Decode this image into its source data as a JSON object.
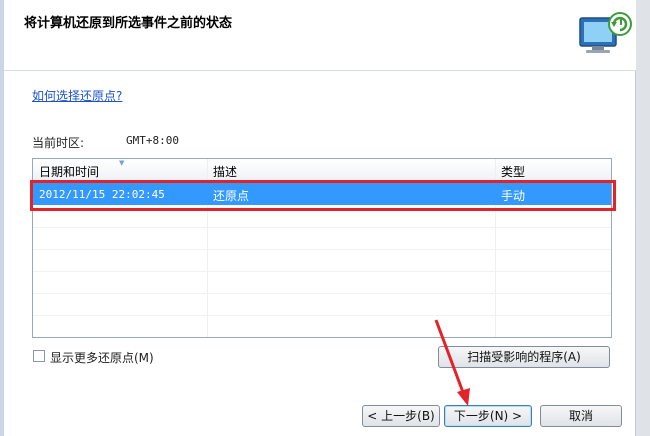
{
  "header": {
    "title": "将计算机还原到所选事件之前的状态"
  },
  "help_link": "如何选择还原点?",
  "timezone": {
    "label": "当前时区:",
    "value": "GMT+8:00"
  },
  "list": {
    "columns": [
      "日期和时间",
      "描述",
      "类型"
    ],
    "rows": [
      {
        "date": "2012/11/15 22:02:45",
        "description": "还原点",
        "type": "手动"
      }
    ]
  },
  "checkbox": {
    "label": "显示更多还原点(M)",
    "checked": false
  },
  "buttons": {
    "scan": "扫描受影响的程序(A)",
    "back": "< 上一步(B)",
    "next": "下一步(N) >",
    "cancel": "取消"
  },
  "colors": {
    "selection": "#3399ff",
    "annotation": "#e2232a",
    "link": "#1a52c9"
  },
  "icons": [
    "system-restore-icon",
    "sort-arrow-icon",
    "annotation-arrow"
  ]
}
